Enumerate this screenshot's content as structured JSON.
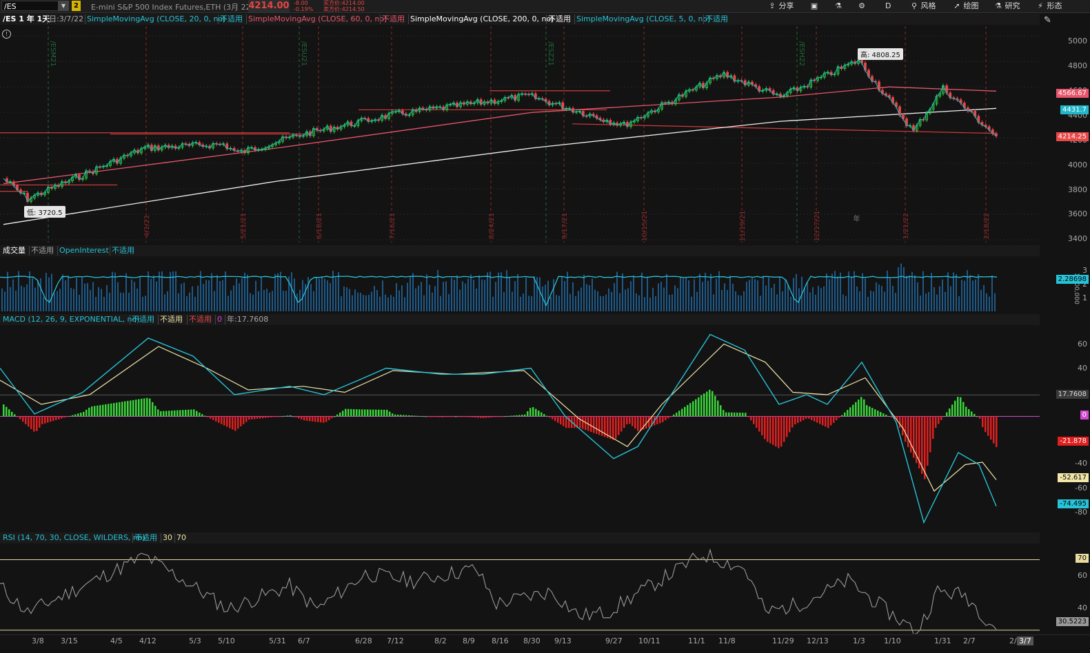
{
  "toolbar": {
    "symbol": "/ES",
    "link_number": "2",
    "description": "E-mini S&P 500 Index Futures,ETH (3月 22)",
    "last_price": "4214.00",
    "change_net": "-8.00",
    "change_pct": "-0.19%",
    "bid": "买方价:4214.00",
    "ask": "卖方价:4214.50",
    "share": "分享",
    "period": "D",
    "style": "风格",
    "draw": "绘图",
    "studies": "研究",
    "patterns": "形态"
  },
  "price_panel": {
    "header": "/ES 1 年 1天",
    "date": "日:3/7/22",
    "studies": [
      {
        "label": "SimpleMovingAvg (CLOSE, 20, 0, no)",
        "value": "不适用",
        "color": "#27c3d8"
      },
      {
        "label": "SimpleMovingAvg (CLOSE, 60, 0, no)",
        "value": "不适用",
        "color": "#e8566b"
      },
      {
        "label": "SimpleMovingAvg (CLOSE, 200, 0, no)",
        "value": "不适用",
        "color": "#ffffff"
      },
      {
        "label": "SimpleMovingAvg (CLOSE, 5, 0, no)",
        "value": "不适用",
        "color": "#27c3d8"
      }
    ],
    "y_ticks": [
      "5000",
      "4800",
      "4600",
      "4400",
      "4200",
      "4000",
      "3800",
      "3600",
      "3400"
    ],
    "high_label": "高: 4808.25",
    "low_label": "低: 3720.5",
    "tags": {
      "sma60": "4566.67",
      "sma200": "4431.7",
      "last": "4214.25"
    },
    "expirations": [
      "/ESM21",
      "/ESU21",
      "/ESZ21",
      "/ESH22"
    ],
    "earnings_dates": [
      "4/1/21",
      "5/21/21",
      "6/18/21",
      "7/16/21",
      "8/24/21",
      "9/17/21",
      "10/15/21",
      "11/19/21",
      "12/17/21",
      "1/21/22",
      "2/18/22"
    ],
    "year_marker": "年"
  },
  "volume_panel": {
    "title": "成交量",
    "title_value": "不适用",
    "study": "OpenInterest",
    "study_value": "不适用",
    "y_ticks": [
      "3",
      "2",
      "1"
    ],
    "oi_tag": "2.28698",
    "units": "1,000,000"
  },
  "macd_panel": {
    "title": "MACD (12, 26, 9, EXPONENTIAL, no)",
    "values": [
      "不适用",
      "不适用",
      "不适用"
    ],
    "zero": "0",
    "year_value": "年:17.7608",
    "y_ticks": [
      "60",
      "40",
      "-40",
      "-60",
      "-80"
    ],
    "tags": {
      "level": "17.7608",
      "zero": "0",
      "diff": "-21.878",
      "avg": "-52.617",
      "value": "-74.495"
    }
  },
  "rsi_panel": {
    "title": "RSI (14, 70, 30, CLOSE, WILDERS, no)",
    "value": "不适用",
    "oversold": "30",
    "overbought": "70",
    "y_ticks": [
      "60",
      "40"
    ],
    "tags": {
      "ob": "70",
      "rsi": "30.5223"
    }
  },
  "x_axis": [
    "3/8",
    "3/15",
    "4/5",
    "4/12",
    "5/3",
    "5/10",
    "5/31",
    "6/7",
    "6/28",
    "7/12",
    "8/2",
    "8/9",
    "8/16",
    "8/30",
    "9/13",
    "9/27",
    "10/11",
    "11/1",
    "11/8",
    "11/29",
    "12/13",
    "1/3",
    "1/10",
    "1/31",
    "2/7",
    "2/28",
    "3/7"
  ],
  "chart_data": [
    {
      "type": "line",
      "title": "/ES 1 年 1天",
      "ylim": [
        3400,
        5050
      ],
      "series": [
        {
          "name": "SimpleMovingAvg (CLOSE, 200, 0, no)",
          "points": [
            [
              "3/1",
              3520
            ],
            [
              "6/1",
              3860
            ],
            [
              "9/1",
              4120
            ],
            [
              "12/1",
              4330
            ],
            [
              "3/7",
              4431.7
            ]
          ]
        },
        {
          "name": "SimpleMovingAvg (CLOSE, 60, 0, no)",
          "points": [
            [
              "3/1",
              3840
            ],
            [
              "6/1",
              4120
            ],
            [
              "9/1",
              4400
            ],
            [
              "12/1",
              4520
            ],
            [
              "1/10",
              4600
            ],
            [
              "3/7",
              4566.67
            ]
          ]
        },
        {
          "name": "Close",
          "points": [
            [
              "3/1",
              3880
            ],
            [
              "3/22",
              3720.5
            ],
            [
              "4/12",
              4120
            ],
            [
              "5/10",
              4150
            ],
            [
              "5/17",
              4080
            ],
            [
              "6/7",
              4230
            ],
            [
              "7/12",
              4380
            ],
            [
              "8/30",
              4530
            ],
            [
              "10/4",
              4300
            ],
            [
              "11/8",
              4700
            ],
            [
              "12/1",
              4520
            ],
            [
              "1/3",
              4808.25
            ],
            [
              "1/24",
              4250
            ],
            [
              "2/2",
              4590
            ],
            [
              "3/7",
              4214.25
            ]
          ]
        }
      ]
    },
    {
      "type": "line",
      "title": "MACD (12, 26, 9, EXPONENTIAL, no)",
      "ylim": [
        -90,
        70
      ],
      "series": [
        {
          "name": "Value",
          "last": -74.495
        },
        {
          "name": "Avg",
          "last": -52.617
        },
        {
          "name": "Diff",
          "last": -21.878
        }
      ]
    },
    {
      "type": "line",
      "title": "RSI (14, 70, 30, CLOSE, WILDERS, no)",
      "ylim": [
        30,
        70
      ],
      "series": [
        {
          "name": "RSI",
          "last": 30.5223
        }
      ]
    }
  ]
}
